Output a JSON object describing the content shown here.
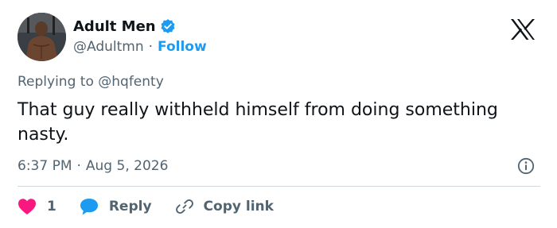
{
  "author": {
    "display_name": "Adult Men",
    "handle": "@Adultmn",
    "separator": "·",
    "follow_label": "Follow",
    "verified": true
  },
  "reply_context": {
    "prefix": "Replying to",
    "mention": "@hqfenty"
  },
  "tweet": {
    "text": "That guy really withheld himself from doing something nasty."
  },
  "meta": {
    "time": "6:37 PM",
    "separator": "·",
    "date": "Aug 5, 2026"
  },
  "actions": {
    "like_count": "1",
    "reply_label": "Reply",
    "copy_label": "Copy link"
  },
  "icons": {
    "logo": "x-logo-icon",
    "verified": "verified-badge-icon",
    "info": "info-icon",
    "like": "heart-icon",
    "reply": "speech-bubble-icon",
    "copy": "link-icon"
  },
  "colors": {
    "accent": "#1d9bf0",
    "like": "#f91880",
    "muted": "#536471",
    "text": "#0f1419",
    "divider": "#cfd9de"
  }
}
